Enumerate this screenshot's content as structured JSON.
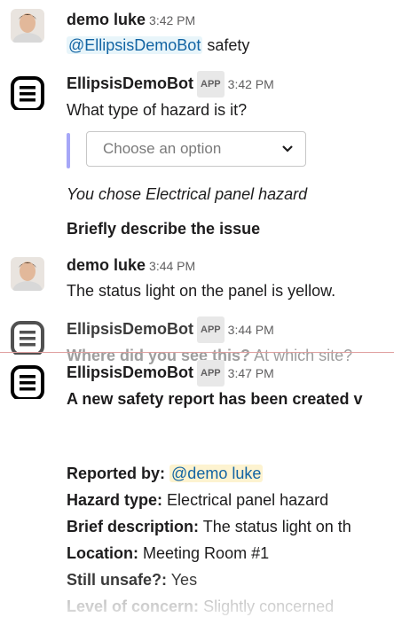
{
  "messages": [
    {
      "sender": "demo luke",
      "time": "3:42 PM",
      "mention": "@EllipsisDemoBot",
      "text": "safety"
    },
    {
      "sender": "EllipsisDemoBot",
      "app_tag": "APP",
      "time": "3:42 PM",
      "question": "What type of hazard is it?",
      "dropdown_placeholder": "Choose an option",
      "chosen": "You chose Electrical panel hazard",
      "prompt": "Briefly describe the issue"
    },
    {
      "sender": "demo luke",
      "time": "3:44 PM",
      "text": "The status light on the panel is yellow."
    },
    {
      "sender": "EllipsisDemoBot",
      "app_tag": "APP",
      "time": "3:44 PM",
      "question_bold": "Where did you see this?",
      "question_rest": "At which site?"
    },
    {
      "sender": "EllipsisDemoBot",
      "app_tag": "APP",
      "time": "3:47 PM",
      "headline": "A new safety report has been created v",
      "fields": [
        {
          "label": "Reported by:",
          "value": "@demo luke"
        },
        {
          "label": "Hazard type:",
          "value": "Electrical panel hazard"
        },
        {
          "label": "Brief description:",
          "value": "The status light on th"
        },
        {
          "label": "Location:",
          "value": "Meeting Room #1"
        },
        {
          "label": "Still unsafe?:",
          "value": "Yes"
        },
        {
          "label": "Level of concern:",
          "value": "Slightly concerned"
        }
      ]
    }
  ],
  "icons": {
    "bot_avatar": "ellipsis-bot-logo-icon",
    "user_avatar": "user-photo",
    "dropdown_chevron": "chevron-down-icon"
  }
}
